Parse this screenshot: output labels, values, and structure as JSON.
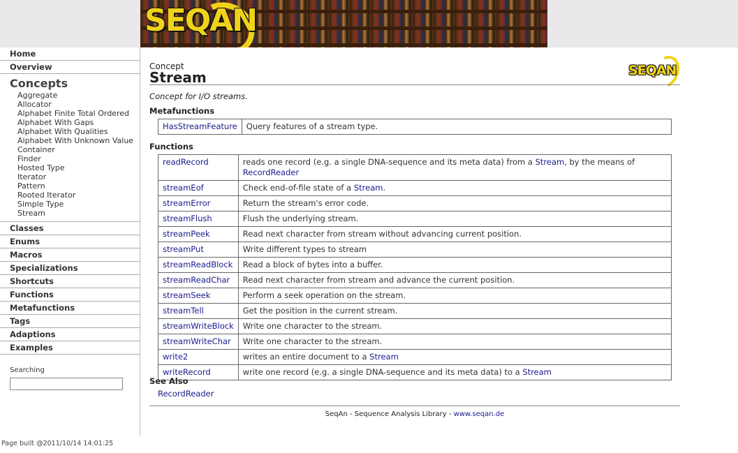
{
  "banner": {
    "logo_text": "SEQAN"
  },
  "sidebar": {
    "home": "Home",
    "overview": "Overview",
    "concepts_title": "Concepts",
    "concepts": [
      "Aggregate",
      "Allocator",
      "Alphabet Finite Total Ordered",
      "Alphabet With Gaps",
      "Alphabet With Qualities",
      "Alphabet With Unknown Value",
      "Container",
      "Finder",
      "Hosted Type",
      "Iterator",
      "Pattern",
      "Rooted Iterator",
      "Simple Type",
      "Stream"
    ],
    "groups": [
      "Classes",
      "Enums",
      "Macros",
      "Specializations",
      "Shortcuts",
      "Functions",
      "Metafunctions",
      "Tags",
      "Adaptions",
      "Examples"
    ],
    "search_label": "Searching",
    "search_value": ""
  },
  "page": {
    "kind": "Concept",
    "title": "Stream",
    "logo_text": "SEQAN",
    "description": "Concept for I/O streams."
  },
  "metafunctions": {
    "heading": "Metafunctions",
    "rows": [
      {
        "name": "HasStreamFeature",
        "desc": "Query features of a stream type."
      }
    ]
  },
  "functions": {
    "heading": "Functions",
    "rows": [
      {
        "name": "readRecord",
        "parts": [
          {
            "t": "reads one record (e.g. a single DNA-sequence and its meta data) from a "
          },
          {
            "t": "Stream",
            "link": true
          },
          {
            "t": ", by the means of "
          },
          {
            "t": "RecordReader",
            "link": true
          }
        ]
      },
      {
        "name": "streamEof",
        "parts": [
          {
            "t": "Check end-of-file state of a "
          },
          {
            "t": "Stream",
            "link": true
          },
          {
            "t": "."
          }
        ]
      },
      {
        "name": "streamError",
        "parts": [
          {
            "t": "Return the stream's error code."
          }
        ]
      },
      {
        "name": "streamFlush",
        "parts": [
          {
            "t": "Flush the underlying stream."
          }
        ]
      },
      {
        "name": "streamPeek",
        "parts": [
          {
            "t": "Read next character from stream without advancing current position."
          }
        ]
      },
      {
        "name": "streamPut",
        "parts": [
          {
            "t": "Write different types to stream"
          }
        ]
      },
      {
        "name": "streamReadBlock",
        "parts": [
          {
            "t": "Read a block of bytes into a buffer."
          }
        ]
      },
      {
        "name": "streamReadChar",
        "parts": [
          {
            "t": "Read next character from stream and advance the current position."
          }
        ]
      },
      {
        "name": "streamSeek",
        "parts": [
          {
            "t": "Perform a seek operation on the stream."
          }
        ]
      },
      {
        "name": "streamTell",
        "parts": [
          {
            "t": "Get the position in the current stream."
          }
        ]
      },
      {
        "name": "streamWriteBlock",
        "parts": [
          {
            "t": "Write one character to the stream."
          }
        ]
      },
      {
        "name": "streamWriteChar",
        "parts": [
          {
            "t": "Write one character to the stream."
          }
        ]
      },
      {
        "name": "write2",
        "parts": [
          {
            "t": "writes an entire document to a "
          },
          {
            "t": "Stream",
            "link": true
          }
        ]
      },
      {
        "name": "writeRecord",
        "parts": [
          {
            "t": "write one record (e.g. a single DNA-sequence and its meta data) to a "
          },
          {
            "t": "Stream",
            "link": true
          }
        ]
      }
    ]
  },
  "see_also": {
    "heading": "See Also",
    "items": [
      "RecordReader"
    ]
  },
  "footer": {
    "text": "SeqAn - Sequence Analysis Library - ",
    "link": "www.seqan.de",
    "built": "Page built @2011/10/14 14:01:25"
  }
}
